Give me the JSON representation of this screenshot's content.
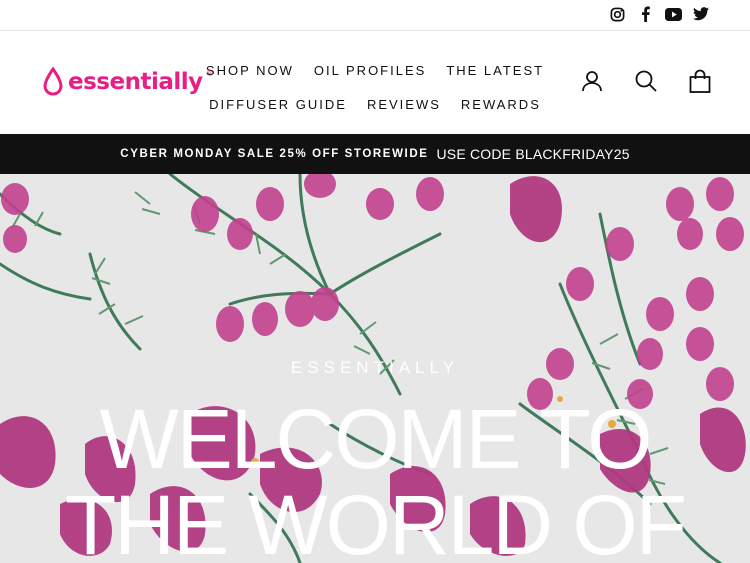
{
  "social": {
    "icons": [
      "instagram-icon",
      "facebook-icon",
      "youtube-icon",
      "twitter-icon"
    ]
  },
  "brand": {
    "name": "essentially",
    "registered": "®",
    "color": "#e91e84"
  },
  "nav": {
    "row1": [
      "SHOP NOW",
      "OIL PROFILES",
      "THE LATEST"
    ],
    "row2": [
      "DIFFUSER GUIDE",
      "REVIEWS",
      "REWARDS"
    ]
  },
  "tools": {
    "icons": [
      "account-icon",
      "search-icon",
      "cart-icon"
    ]
  },
  "promo": {
    "headline": "CYBER MONDAY SALE 25% OFF STOREWIDE",
    "code": "USE CODE BLACKFRIDAY25",
    "background": "#111111"
  },
  "hero": {
    "subtitle": "ESSENTIALLY",
    "title_line1": "WELCOME TO",
    "title_line2": "THE WORLD OF",
    "accent": "#c2418f",
    "leaf": "#3f7a5a"
  }
}
